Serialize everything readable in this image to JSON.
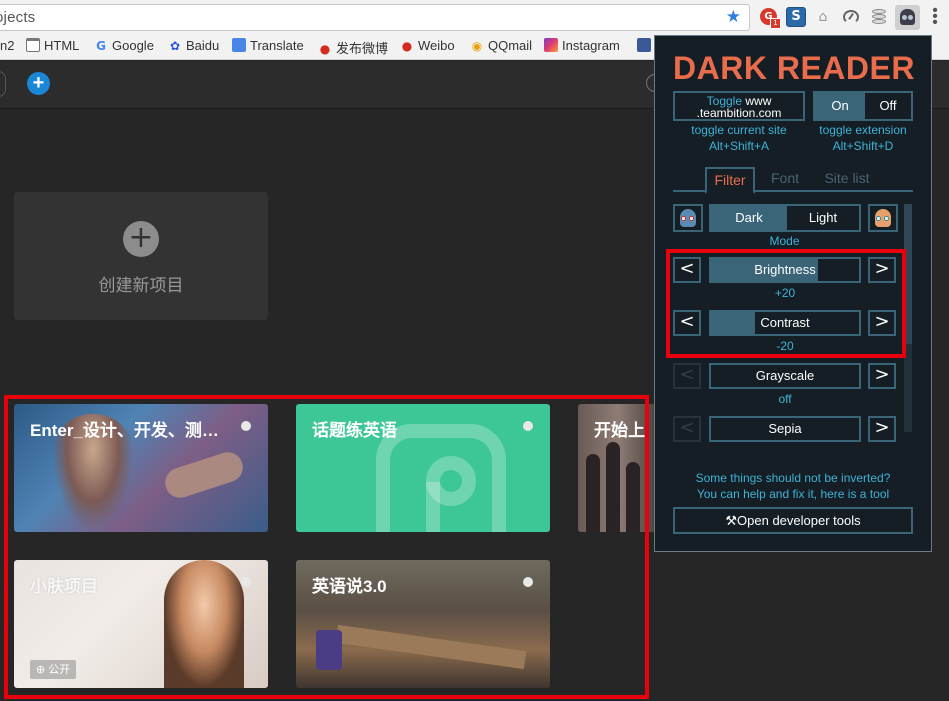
{
  "browser": {
    "address_text": "ojects",
    "bookmarks": [
      {
        "label": "n2"
      },
      {
        "label": "HTML"
      },
      {
        "label": "Google"
      },
      {
        "label": "Baidu"
      },
      {
        "label": "Translate"
      },
      {
        "label": "发布微博"
      },
      {
        "label": "Weibo"
      },
      {
        "label": "QQmail"
      },
      {
        "label": "Instagram"
      }
    ],
    "extensions": [
      "ghostery-icon",
      "s-ext-icon",
      "hat-icon",
      "speedometer-icon",
      "database-icon",
      "dark-reader-icon"
    ]
  },
  "app": {
    "create_card_label": "创建新项目",
    "projects": [
      {
        "title": "Enter_设计、开发、测…"
      },
      {
        "title": "话题练英语"
      },
      {
        "title": "开始上"
      },
      {
        "title": "小肤项目",
        "badge": "公开"
      },
      {
        "title": "英语说3.0"
      }
    ],
    "colors": {
      "accent": "#1b85d6",
      "project_green": "#3ec796",
      "highlight": "#e8000d"
    }
  },
  "dark_reader": {
    "title": "DARK READER",
    "toggle_site": {
      "label": "Toggle",
      "site": "www\n.teambition.com"
    },
    "toggle_site_note": [
      "toggle current site",
      "Alt+Shift+A"
    ],
    "extension_switch": {
      "on": "On",
      "off": "Off"
    },
    "toggle_ext_note": [
      "toggle extension",
      "Alt+Shift+D"
    ],
    "tabs": [
      "Filter",
      "Font",
      "Site list"
    ],
    "mode": {
      "dark": "Dark",
      "light": "Light",
      "label": "Mode"
    },
    "sliders": [
      {
        "name": "Brightness",
        "value": "+20",
        "fill": 0.72
      },
      {
        "name": "Contrast",
        "value": "-20",
        "fill": 0.3
      },
      {
        "name": "Grayscale",
        "value": "off",
        "fill": 0
      },
      {
        "name": "Sepia",
        "value": "",
        "fill": 0
      }
    ],
    "fix_note": [
      "Some things should not be inverted?",
      "You can help and fix it, here is a tool"
    ],
    "devtools_button": "Open developer tools",
    "colors": {
      "title": "#e96c4c",
      "border": "#3a6478",
      "note": "#3fb2d8",
      "background": "#141e24"
    }
  }
}
